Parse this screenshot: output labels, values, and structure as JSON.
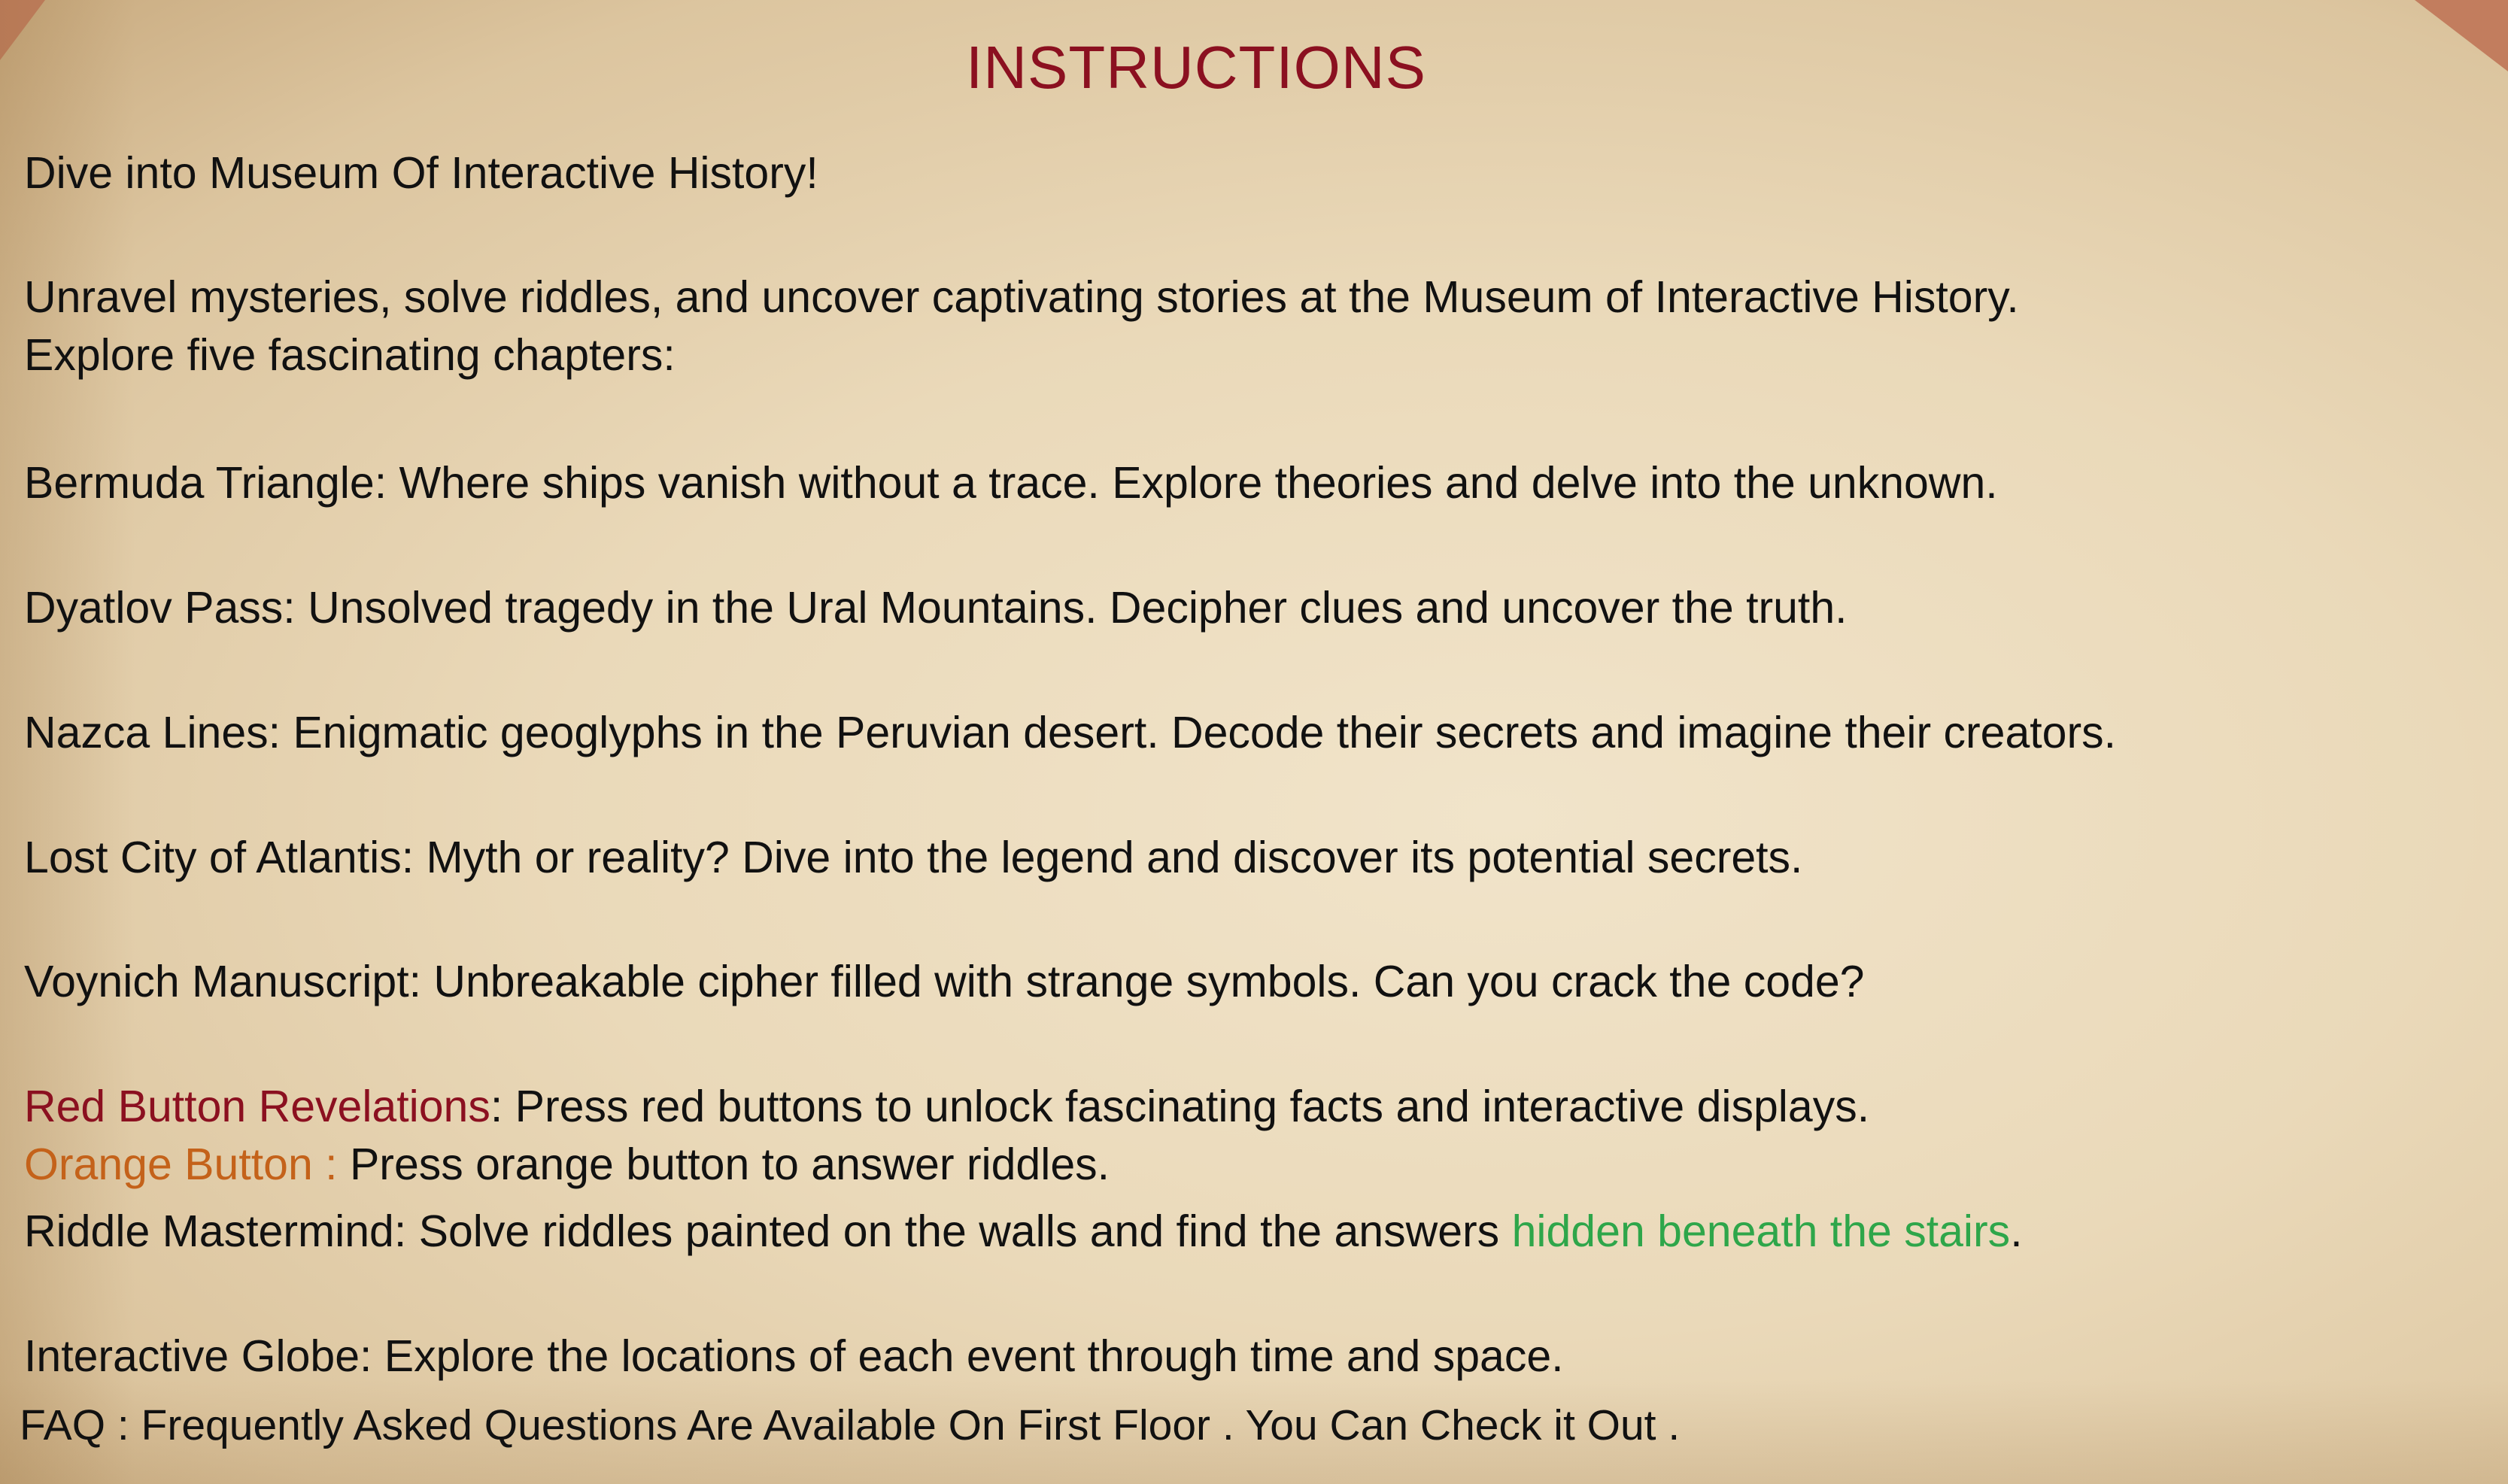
{
  "title": "INSTRUCTIONS",
  "intro": "Dive into Museum Of Interactive History!",
  "summary_line1": "Unravel mysteries, solve riddles, and uncover captivating stories at the Museum of Interactive History.",
  "summary_line2": "Explore five fascinating chapters:",
  "chapters": [
    "Bermuda Triangle: Where ships vanish without a trace. Explore theories and delve into the unknown.",
    "Dyatlov Pass: Unsolved tragedy in the Ural Mountains. Decipher clues and uncover the truth.",
    "Nazca Lines: Enigmatic geoglyphs in the Peruvian desert. Decode their secrets and imagine their creators.",
    "Lost City of Atlantis: Myth or reality? Dive into the legend and discover its potential secrets.",
    "Voynich Manuscript: Unbreakable cipher filled with strange symbols. Can you crack the code?"
  ],
  "red_button": {
    "label": "Red Button Revelations",
    "text": ": Press red buttons to unlock fascinating facts and interactive displays."
  },
  "orange_button": {
    "label": "Orange Button :",
    "text": " Press orange button to answer riddles."
  },
  "riddle": {
    "text": "Riddle Mastermind: Solve riddles painted on the walls and find the answers ",
    "highlight": "hidden beneath the stairs",
    "end": "."
  },
  "globe": "Interactive Globe: Explore the locations of each event through time and space.",
  "faq": "FAQ : Frequently Asked Questions Are Available On First Floor . You Can Check it Out .",
  "colors": {
    "title": "#8b1020",
    "red": "#8b1020",
    "orange": "#c4621a",
    "green": "#2ea64a",
    "paper": "#ead9b9",
    "corner": "#c27d5e"
  }
}
